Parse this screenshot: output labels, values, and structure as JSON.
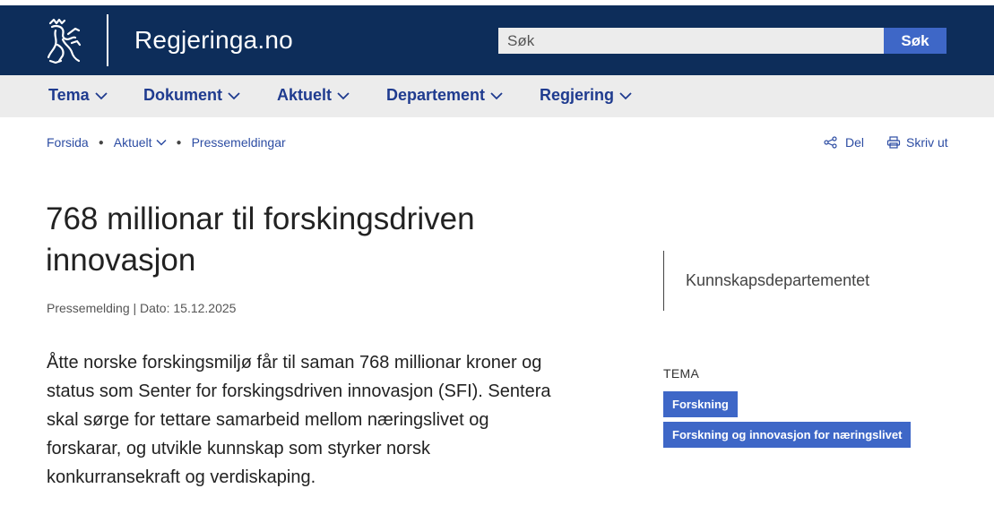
{
  "header": {
    "site_name": "Regjeringa.no",
    "logo_icon": "norwegian-lion-coat-of-arms-icon",
    "search": {
      "placeholder": "Søk",
      "button_label": "Søk"
    }
  },
  "nav": {
    "items": [
      {
        "label": "Tema"
      },
      {
        "label": "Dokument"
      },
      {
        "label": "Aktuelt"
      },
      {
        "label": "Departement"
      },
      {
        "label": "Regjering"
      }
    ]
  },
  "breadcrumb": {
    "items": [
      {
        "label": "Forsida"
      },
      {
        "label": "Aktuelt"
      },
      {
        "label": "Pressemeldingar"
      }
    ]
  },
  "tools": {
    "share_label": "Del",
    "print_label": "Skriv ut"
  },
  "article": {
    "title": "768 millionar til forskingsdriven innovasjon",
    "meta": "Pressemelding | Dato: 15.12.2025",
    "lead": "Åtte norske forskingsmiljø får til saman 768 millionar kroner og status som Senter for forskingsdriven innovasjon (SFI). Sentera skal sørge for tettare samarbeid mellom næringslivet og forskarar, og utvikle kunnskap som styrker norsk konkurransekraft og verdiskaping."
  },
  "sidebar": {
    "department": "Kunnskapsdepartementet",
    "tema_label": "TEMA",
    "tags": [
      {
        "label": "Forskning"
      },
      {
        "label": "Forskning og innovasjon for næringslivet"
      }
    ]
  },
  "colors": {
    "header_bg": "#0d2d5a",
    "nav_bg": "#ececec",
    "accent": "#3e67c7",
    "link": "#2d4da3"
  }
}
